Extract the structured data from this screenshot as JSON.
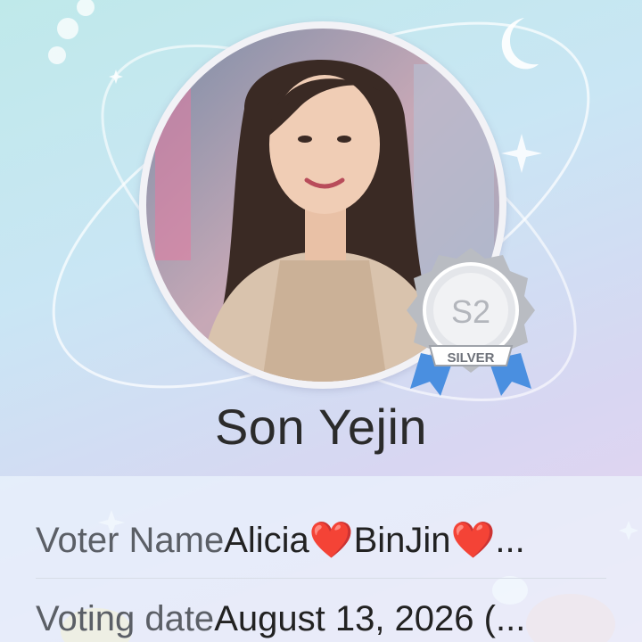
{
  "profile": {
    "name": "Son Yejin",
    "badge_label": "SILVER",
    "badge_logo_text": "S2"
  },
  "details": {
    "voter_label": "Voter Name",
    "voter_value": "Alicia❤️BinJin❤️...",
    "date_label": "Voting date",
    "date_value": "August 13, 2026 (..."
  },
  "colors": {
    "name_text": "#2b2b2b",
    "label_text": "#5b5f66",
    "badge_ribbon": "#4a8fe0",
    "badge_silver": "#c9cbd0"
  },
  "icons": [
    "moon-icon",
    "sparkle-icon",
    "silver-medal-icon"
  ]
}
